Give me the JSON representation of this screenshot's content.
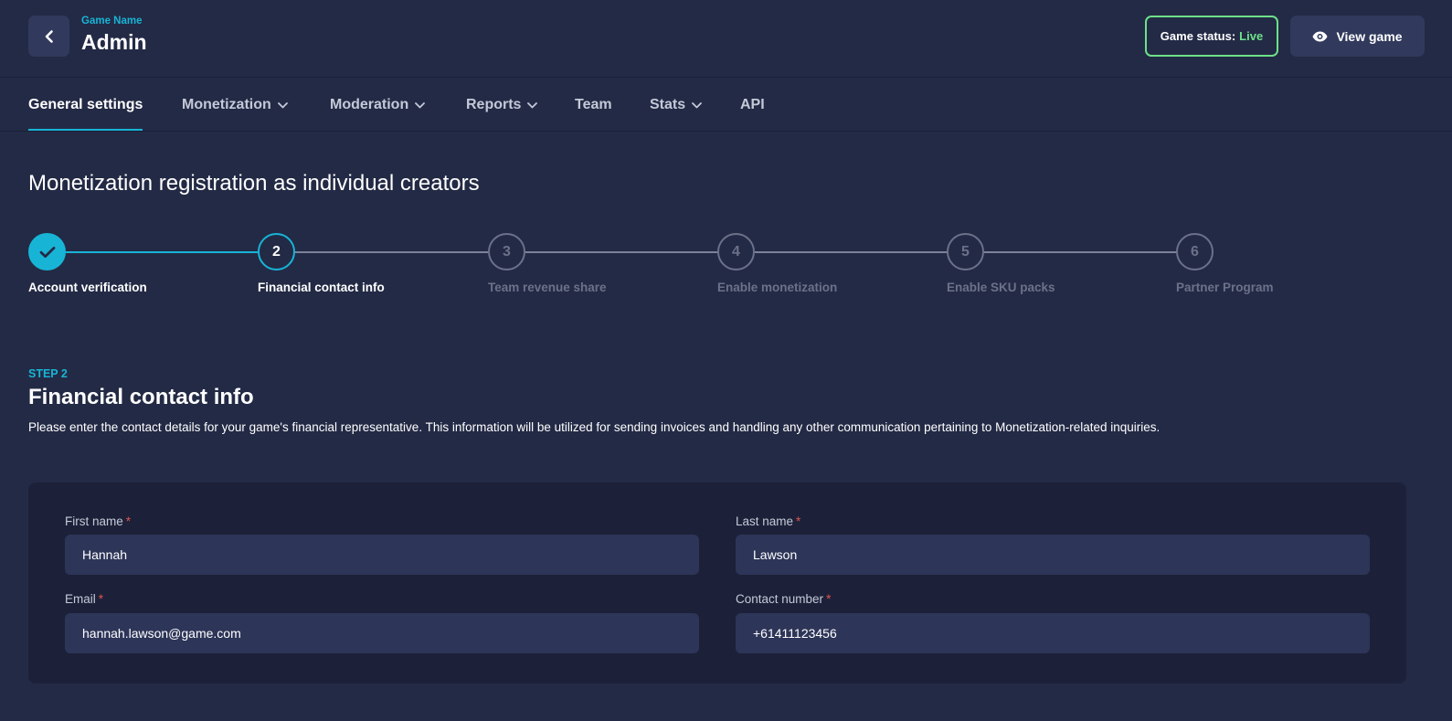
{
  "header": {
    "back_icon": "chevron-left-icon",
    "game_name": "Game Name",
    "title": "Admin",
    "status_label": "Game status:",
    "status_value": "Live",
    "view_label": "View game",
    "view_icon": "eye-icon"
  },
  "nav": {
    "items": [
      {
        "label": "General settings",
        "active": true,
        "dropdown": false
      },
      {
        "label": "Monetization",
        "active": false,
        "dropdown": true
      },
      {
        "label": "Moderation",
        "active": false,
        "dropdown": true
      },
      {
        "label": "Reports",
        "active": false,
        "dropdown": true
      },
      {
        "label": "Team",
        "active": false,
        "dropdown": false
      },
      {
        "label": "Stats",
        "active": false,
        "dropdown": true
      },
      {
        "label": "API",
        "active": false,
        "dropdown": false
      }
    ]
  },
  "page": {
    "title": "Monetization registration as individual creators"
  },
  "stepper": {
    "steps": [
      {
        "number": "1",
        "label": "Account verification",
        "state": "done"
      },
      {
        "number": "2",
        "label": "Financial contact info",
        "state": "current"
      },
      {
        "number": "3",
        "label": "Team revenue share",
        "state": "upcoming"
      },
      {
        "number": "4",
        "label": "Enable monetization",
        "state": "upcoming"
      },
      {
        "number": "5",
        "label": "Enable SKU packs",
        "state": "upcoming"
      },
      {
        "number": "6",
        "label": "Partner Program",
        "state": "upcoming"
      }
    ]
  },
  "step": {
    "kicker": "STEP 2",
    "title": "Financial contact info",
    "description": "Please enter the contact details for your game's financial representative. This information will be utilized for sending invoices and handling any other communication pertaining to Monetization-related inquiries."
  },
  "form": {
    "required_mark": "*",
    "first_name": {
      "label": "First name",
      "value": "Hannah"
    },
    "last_name": {
      "label": "Last name",
      "value": "Lawson"
    },
    "email": {
      "label": "Email",
      "value": "hannah.lawson@game.com"
    },
    "contact_number": {
      "label": "Contact number",
      "value": "+61411123456"
    }
  },
  "colors": {
    "background": "#232a45",
    "accent": "#18b4d6",
    "live": "#6ee08a",
    "required": "#e0524f"
  }
}
